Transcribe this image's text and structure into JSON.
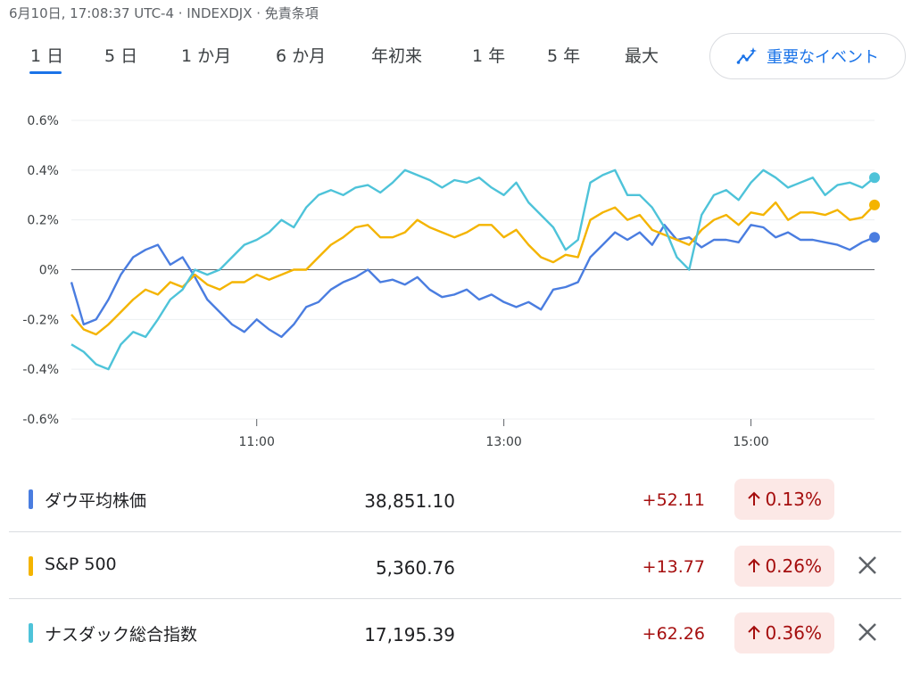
{
  "header": {
    "timestamp": "6月10日, 17:08:37 UTC-4 · INDEXDJX · 免責条項"
  },
  "tabs": [
    {
      "label": "1 日",
      "active": true
    },
    {
      "label": "5 日",
      "active": false
    },
    {
      "label": "1 か月",
      "active": false
    },
    {
      "label": "6 か月",
      "active": false
    },
    {
      "label": "年初来",
      "active": false
    },
    {
      "label": "1 年",
      "active": false
    },
    {
      "label": "5 年",
      "active": false
    },
    {
      "label": "最大",
      "active": false
    }
  ],
  "events_button": {
    "label": "重要なイベント",
    "icon": "trend-sparkle-icon"
  },
  "colors": {
    "dow": "#4a7de0",
    "sp": "#f4b400",
    "nasdaq": "#4ec3d9",
    "accent": "#1a73e8",
    "up": "#a50e0e",
    "up_bg": "#fce8e6"
  },
  "chart_data": {
    "type": "line",
    "y_ticks": [
      "0.6%",
      "0.4%",
      "0.2%",
      "0%",
      "-0.2%",
      "-0.4%",
      "-0.6%"
    ],
    "x_ticks": [
      "11:00",
      "13:00",
      "15:00"
    ],
    "ylim": [
      -0.6,
      0.6
    ],
    "xlim_hours": [
      9.5,
      16.0
    ],
    "grid": true,
    "series": [
      {
        "name": "ダウ平均株価",
        "color": "#4a7de0",
        "x": [
          9.5,
          9.6,
          9.7,
          9.8,
          9.9,
          10.0,
          10.1,
          10.2,
          10.3,
          10.4,
          10.5,
          10.6,
          10.7,
          10.8,
          10.9,
          11.0,
          11.1,
          11.2,
          11.3,
          11.4,
          11.5,
          11.6,
          11.7,
          11.8,
          11.9,
          12.0,
          12.1,
          12.2,
          12.3,
          12.4,
          12.5,
          12.6,
          12.7,
          12.8,
          12.9,
          13.0,
          13.1,
          13.2,
          13.3,
          13.4,
          13.5,
          13.6,
          13.7,
          13.8,
          13.9,
          14.0,
          14.1,
          14.2,
          14.3,
          14.4,
          14.5,
          14.6,
          14.7,
          14.8,
          14.9,
          15.0,
          15.1,
          15.2,
          15.3,
          15.4,
          15.5,
          15.6,
          15.7,
          15.8,
          15.9,
          16.0
        ],
        "values": [
          -0.05,
          -0.22,
          -0.2,
          -0.12,
          -0.02,
          0.05,
          0.08,
          0.1,
          0.02,
          0.05,
          -0.03,
          -0.12,
          -0.17,
          -0.22,
          -0.25,
          -0.2,
          -0.24,
          -0.27,
          -0.22,
          -0.15,
          -0.13,
          -0.08,
          -0.05,
          -0.03,
          0.0,
          -0.05,
          -0.04,
          -0.06,
          -0.03,
          -0.08,
          -0.11,
          -0.1,
          -0.08,
          -0.12,
          -0.1,
          -0.13,
          -0.15,
          -0.13,
          -0.16,
          -0.08,
          -0.07,
          -0.05,
          0.05,
          0.1,
          0.15,
          0.12,
          0.15,
          0.1,
          0.18,
          0.12,
          0.13,
          0.09,
          0.12,
          0.12,
          0.11,
          0.18,
          0.17,
          0.13,
          0.15,
          0.12,
          0.12,
          0.11,
          0.1,
          0.08,
          0.11,
          0.13
        ]
      },
      {
        "name": "S&P 500",
        "color": "#f4b400",
        "x": [
          9.5,
          9.6,
          9.7,
          9.8,
          9.9,
          10.0,
          10.1,
          10.2,
          10.3,
          10.4,
          10.5,
          10.6,
          10.7,
          10.8,
          10.9,
          11.0,
          11.1,
          11.2,
          11.3,
          11.4,
          11.5,
          11.6,
          11.7,
          11.8,
          11.9,
          12.0,
          12.1,
          12.2,
          12.3,
          12.4,
          12.5,
          12.6,
          12.7,
          12.8,
          12.9,
          13.0,
          13.1,
          13.2,
          13.3,
          13.4,
          13.5,
          13.6,
          13.7,
          13.8,
          13.9,
          14.0,
          14.1,
          14.2,
          14.3,
          14.4,
          14.5,
          14.6,
          14.7,
          14.8,
          14.9,
          15.0,
          15.1,
          15.2,
          15.3,
          15.4,
          15.5,
          15.6,
          15.7,
          15.8,
          15.9,
          16.0
        ],
        "values": [
          -0.18,
          -0.24,
          -0.26,
          -0.22,
          -0.17,
          -0.12,
          -0.08,
          -0.1,
          -0.05,
          -0.07,
          -0.02,
          -0.06,
          -0.08,
          -0.05,
          -0.05,
          -0.02,
          -0.04,
          -0.02,
          0.0,
          0.0,
          0.05,
          0.1,
          0.13,
          0.17,
          0.18,
          0.13,
          0.13,
          0.15,
          0.2,
          0.17,
          0.15,
          0.13,
          0.15,
          0.18,
          0.18,
          0.13,
          0.16,
          0.1,
          0.05,
          0.03,
          0.06,
          0.05,
          0.2,
          0.23,
          0.25,
          0.2,
          0.22,
          0.16,
          0.14,
          0.12,
          0.1,
          0.16,
          0.2,
          0.22,
          0.18,
          0.23,
          0.22,
          0.27,
          0.2,
          0.23,
          0.23,
          0.22,
          0.24,
          0.2,
          0.21,
          0.26
        ]
      },
      {
        "name": "ナスダック総合指数",
        "color": "#4ec3d9",
        "x": [
          9.5,
          9.6,
          9.7,
          9.8,
          9.9,
          10.0,
          10.1,
          10.2,
          10.3,
          10.4,
          10.5,
          10.6,
          10.7,
          10.8,
          10.9,
          11.0,
          11.1,
          11.2,
          11.3,
          11.4,
          11.5,
          11.6,
          11.7,
          11.8,
          11.9,
          12.0,
          12.1,
          12.2,
          12.3,
          12.4,
          12.5,
          12.6,
          12.7,
          12.8,
          12.9,
          13.0,
          13.1,
          13.2,
          13.3,
          13.4,
          13.5,
          13.6,
          13.7,
          13.8,
          13.9,
          14.0,
          14.1,
          14.2,
          14.3,
          14.4,
          14.5,
          14.6,
          14.7,
          14.8,
          14.9,
          15.0,
          15.1,
          15.2,
          15.3,
          15.4,
          15.5,
          15.6,
          15.7,
          15.8,
          15.9,
          16.0
        ],
        "values": [
          -0.3,
          -0.33,
          -0.38,
          -0.4,
          -0.3,
          -0.25,
          -0.27,
          -0.2,
          -0.12,
          -0.08,
          0.0,
          -0.02,
          0.0,
          0.05,
          0.1,
          0.12,
          0.15,
          0.2,
          0.17,
          0.25,
          0.3,
          0.32,
          0.3,
          0.33,
          0.34,
          0.31,
          0.35,
          0.4,
          0.38,
          0.36,
          0.33,
          0.36,
          0.35,
          0.37,
          0.33,
          0.3,
          0.35,
          0.27,
          0.22,
          0.17,
          0.08,
          0.12,
          0.35,
          0.38,
          0.4,
          0.3,
          0.3,
          0.25,
          0.17,
          0.05,
          0.0,
          0.22,
          0.3,
          0.32,
          0.28,
          0.35,
          0.4,
          0.37,
          0.33,
          0.35,
          0.37,
          0.3,
          0.34,
          0.35,
          0.33,
          0.37
        ]
      }
    ]
  },
  "rows": [
    {
      "name": "ダウ平均株価",
      "price": "38,851.10",
      "change": "+52.11",
      "pct": "0.13%",
      "color": "#4a7de0",
      "closable": false
    },
    {
      "name": "S&P 500",
      "price": "5,360.76",
      "change": "+13.77",
      "pct": "0.26%",
      "color": "#f4b400",
      "closable": true
    },
    {
      "name": "ナスダック総合指数",
      "price": "17,195.39",
      "change": "+62.26",
      "pct": "0.36%",
      "color": "#4ec3d9",
      "closable": true
    }
  ]
}
